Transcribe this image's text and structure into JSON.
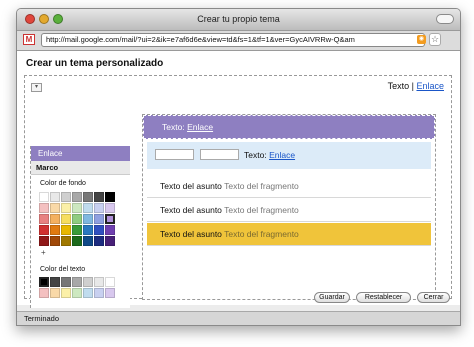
{
  "window": {
    "title": "Crear tu propio tema"
  },
  "urlbar": {
    "favicon": "M",
    "url": "http://mail.google.com/mail/?ui=2&ik=e7af6d6e&view=td&fs=1&tf=1&ver=GycAIVRRw-Q&am",
    "feed_icon": "rss-icon",
    "search_icon": "google-search-icon"
  },
  "page": {
    "title": "Crear un tema personalizado",
    "top_text": "Texto",
    "top_sep": "|",
    "top_link": "Enlace"
  },
  "preview": {
    "header_text": "Texto:",
    "header_link": "Enlace",
    "toolbar_text": "Texto:",
    "toolbar_link": "Enlace",
    "rows": [
      {
        "subject": "Texto del asunto",
        "fragment": "Texto del fragmento"
      },
      {
        "subject": "Texto del asunto",
        "fragment": "Texto del fragmento"
      },
      {
        "subject": "Texto del asunto",
        "fragment": "Texto del fragmento"
      }
    ],
    "colors": {
      "header": "#8e7fc1",
      "toolbar": "#dcebf8",
      "selected_row": "#f0c43a"
    }
  },
  "left_panel": {
    "header": "Enlace",
    "section": "Marco",
    "bg_label": "Color de fondo",
    "text_label": "Color del texto",
    "plus": "+",
    "bg_palette": [
      "#ffffff",
      "#e8e8e8",
      "#cfcfcf",
      "#a8a8a8",
      "#777777",
      "#444444",
      "#000000",
      "#f4c0c0",
      "#f9d9a8",
      "#fbf0a8",
      "#cde8c0",
      "#c0dcee",
      "#c8d0f0",
      "#d8c8ee",
      "#e88080",
      "#f4b060",
      "#f6de60",
      "#90cc80",
      "#80b8e0",
      "#8fa0e0",
      "#b090d8",
      "#d03030",
      "#e07a10",
      "#e8b800",
      "#3a9a3a",
      "#2a78c0",
      "#3050c0",
      "#7040b0",
      "#901818",
      "#a04808",
      "#a07800",
      "#1c6a1c",
      "#104a88",
      "#1c2c80",
      "#482078"
    ],
    "bg_selected_index": 20,
    "text_palette": [
      "#000000",
      "#444444",
      "#777777",
      "#a8a8a8",
      "#cfcfcf",
      "#e8e8e8",
      "#ffffff",
      "#f4c0c0",
      "#f9d9a8",
      "#fbf0a8",
      "#cde8c0",
      "#c0dcee",
      "#c8d0f0",
      "#d8c8ee"
    ],
    "text_selected_index": 0
  },
  "actions": {
    "save": "Guardar",
    "reset": "Restablecer",
    "cancel": "Cerrar"
  },
  "status": {
    "text": "Terminado"
  }
}
